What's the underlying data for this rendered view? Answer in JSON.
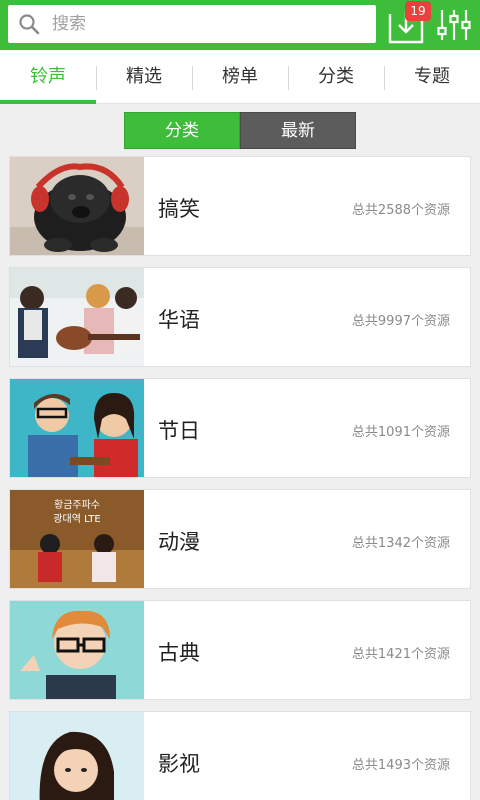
{
  "search": {
    "placeholder": "搜索"
  },
  "download": {
    "badge_count": "19"
  },
  "tabs": [
    {
      "label": "铃声",
      "active": true
    },
    {
      "label": "精选",
      "active": false
    },
    {
      "label": "榜单",
      "active": false
    },
    {
      "label": "分类",
      "active": false
    },
    {
      "label": "专题",
      "active": false
    }
  ],
  "segment": {
    "left_label": "分类",
    "right_label": "最新",
    "selected": "分类"
  },
  "categories": [
    {
      "title": "搞笑",
      "count": "总共2588个资源"
    },
    {
      "title": "华语",
      "count": "总共9997个资源"
    },
    {
      "title": "节日",
      "count": "总共1091个资源"
    },
    {
      "title": "动漫",
      "count": "总共1342个资源"
    },
    {
      "title": "古典",
      "count": "总共1421个资源"
    },
    {
      "title": "影视",
      "count": "总共1493个资源"
    }
  ],
  "thumb_text": {
    "line1": "황금주파수",
    "line2": "광대역 LTE"
  },
  "colors": {
    "accent": "#3dbd3a",
    "badge": "#e9413e",
    "segment_off": "#5c5c5c"
  }
}
